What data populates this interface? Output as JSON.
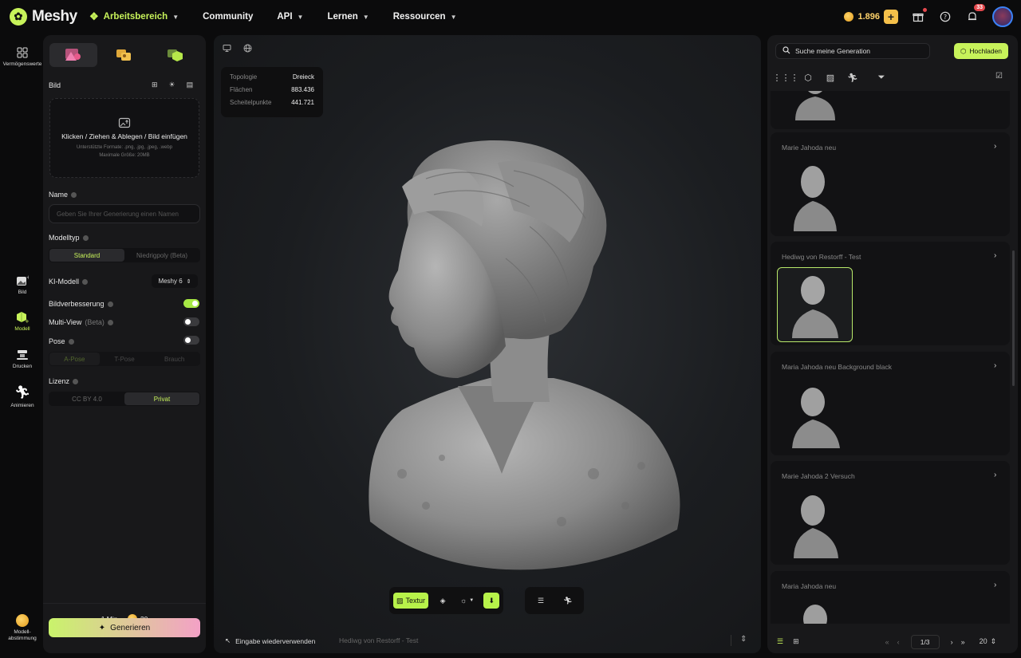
{
  "app": {
    "name": "Meshy"
  },
  "nav": {
    "workspace": "Arbeitsbereich",
    "community": "Community",
    "api": "API",
    "learn": "Lernen",
    "resources": "Ressourcen"
  },
  "topright": {
    "credits": "1.896",
    "notifications": "33"
  },
  "rail": {
    "assets": "Vermögenswerte",
    "image": "Bild",
    "model": "Modell",
    "print": "Drucken",
    "animate": "Animieren",
    "model_vote": "Modell-\nabstimmung"
  },
  "left": {
    "image_label": "Bild",
    "drop_main": "Klicken / Ziehen & Ablegen / Bild einfügen",
    "drop_formats": "Unterstützte Formate: .png, .jpg, .jpeg, .webp",
    "drop_size": "Maximale Größe: 20MB",
    "name_label": "Name",
    "name_placeholder": "Geben Sie Ihrer Generierung einen Namen",
    "modeltype_label": "Modelltyp",
    "modeltype_options": [
      "Standard",
      "Niedrigpoly (Beta)"
    ],
    "ai_model_label": "KI-Modell",
    "ai_model_value": "Meshy 6",
    "enhance_label": "Bildverbesserung",
    "enhance_on": true,
    "multiview_label": "Multi-View",
    "multiview_beta": "(Beta)",
    "multiview_on": false,
    "pose_label": "Pose",
    "pose_on": false,
    "pose_options": [
      "A-Pose",
      "T-Pose",
      "Brauch"
    ],
    "license_label": "Lizenz",
    "license_options": [
      "CC BY 4.0",
      "Privat"
    ],
    "time": "1 Min.",
    "cost": "20",
    "generate": "Generieren"
  },
  "viewport": {
    "stats": [
      {
        "k": "Topologie",
        "v": "Dreieck"
      },
      {
        "k": "Flächen",
        "v": "883.436"
      },
      {
        "k": "Scheitelpunkte",
        "v": "441.721"
      }
    ],
    "texture_btn": "Textur",
    "reuse": "Eingabe wiederverwenden",
    "current": "Hediwg von Restorff - Test"
  },
  "right": {
    "search_placeholder": "Suche meine Generation",
    "upload": "Hochladen",
    "items": [
      "Marie Jahoda neu",
      "Hediwg von Restorff - Test",
      "Maria Jahoda neu Background black",
      "Marie Jahoda 2 Versuch",
      "Maria Jahoda neu"
    ],
    "page": "1/3",
    "per_page": "20"
  },
  "colors": {
    "accent": "#c7f25a",
    "panel": "#18181a",
    "bg": "#0b0b0c"
  }
}
